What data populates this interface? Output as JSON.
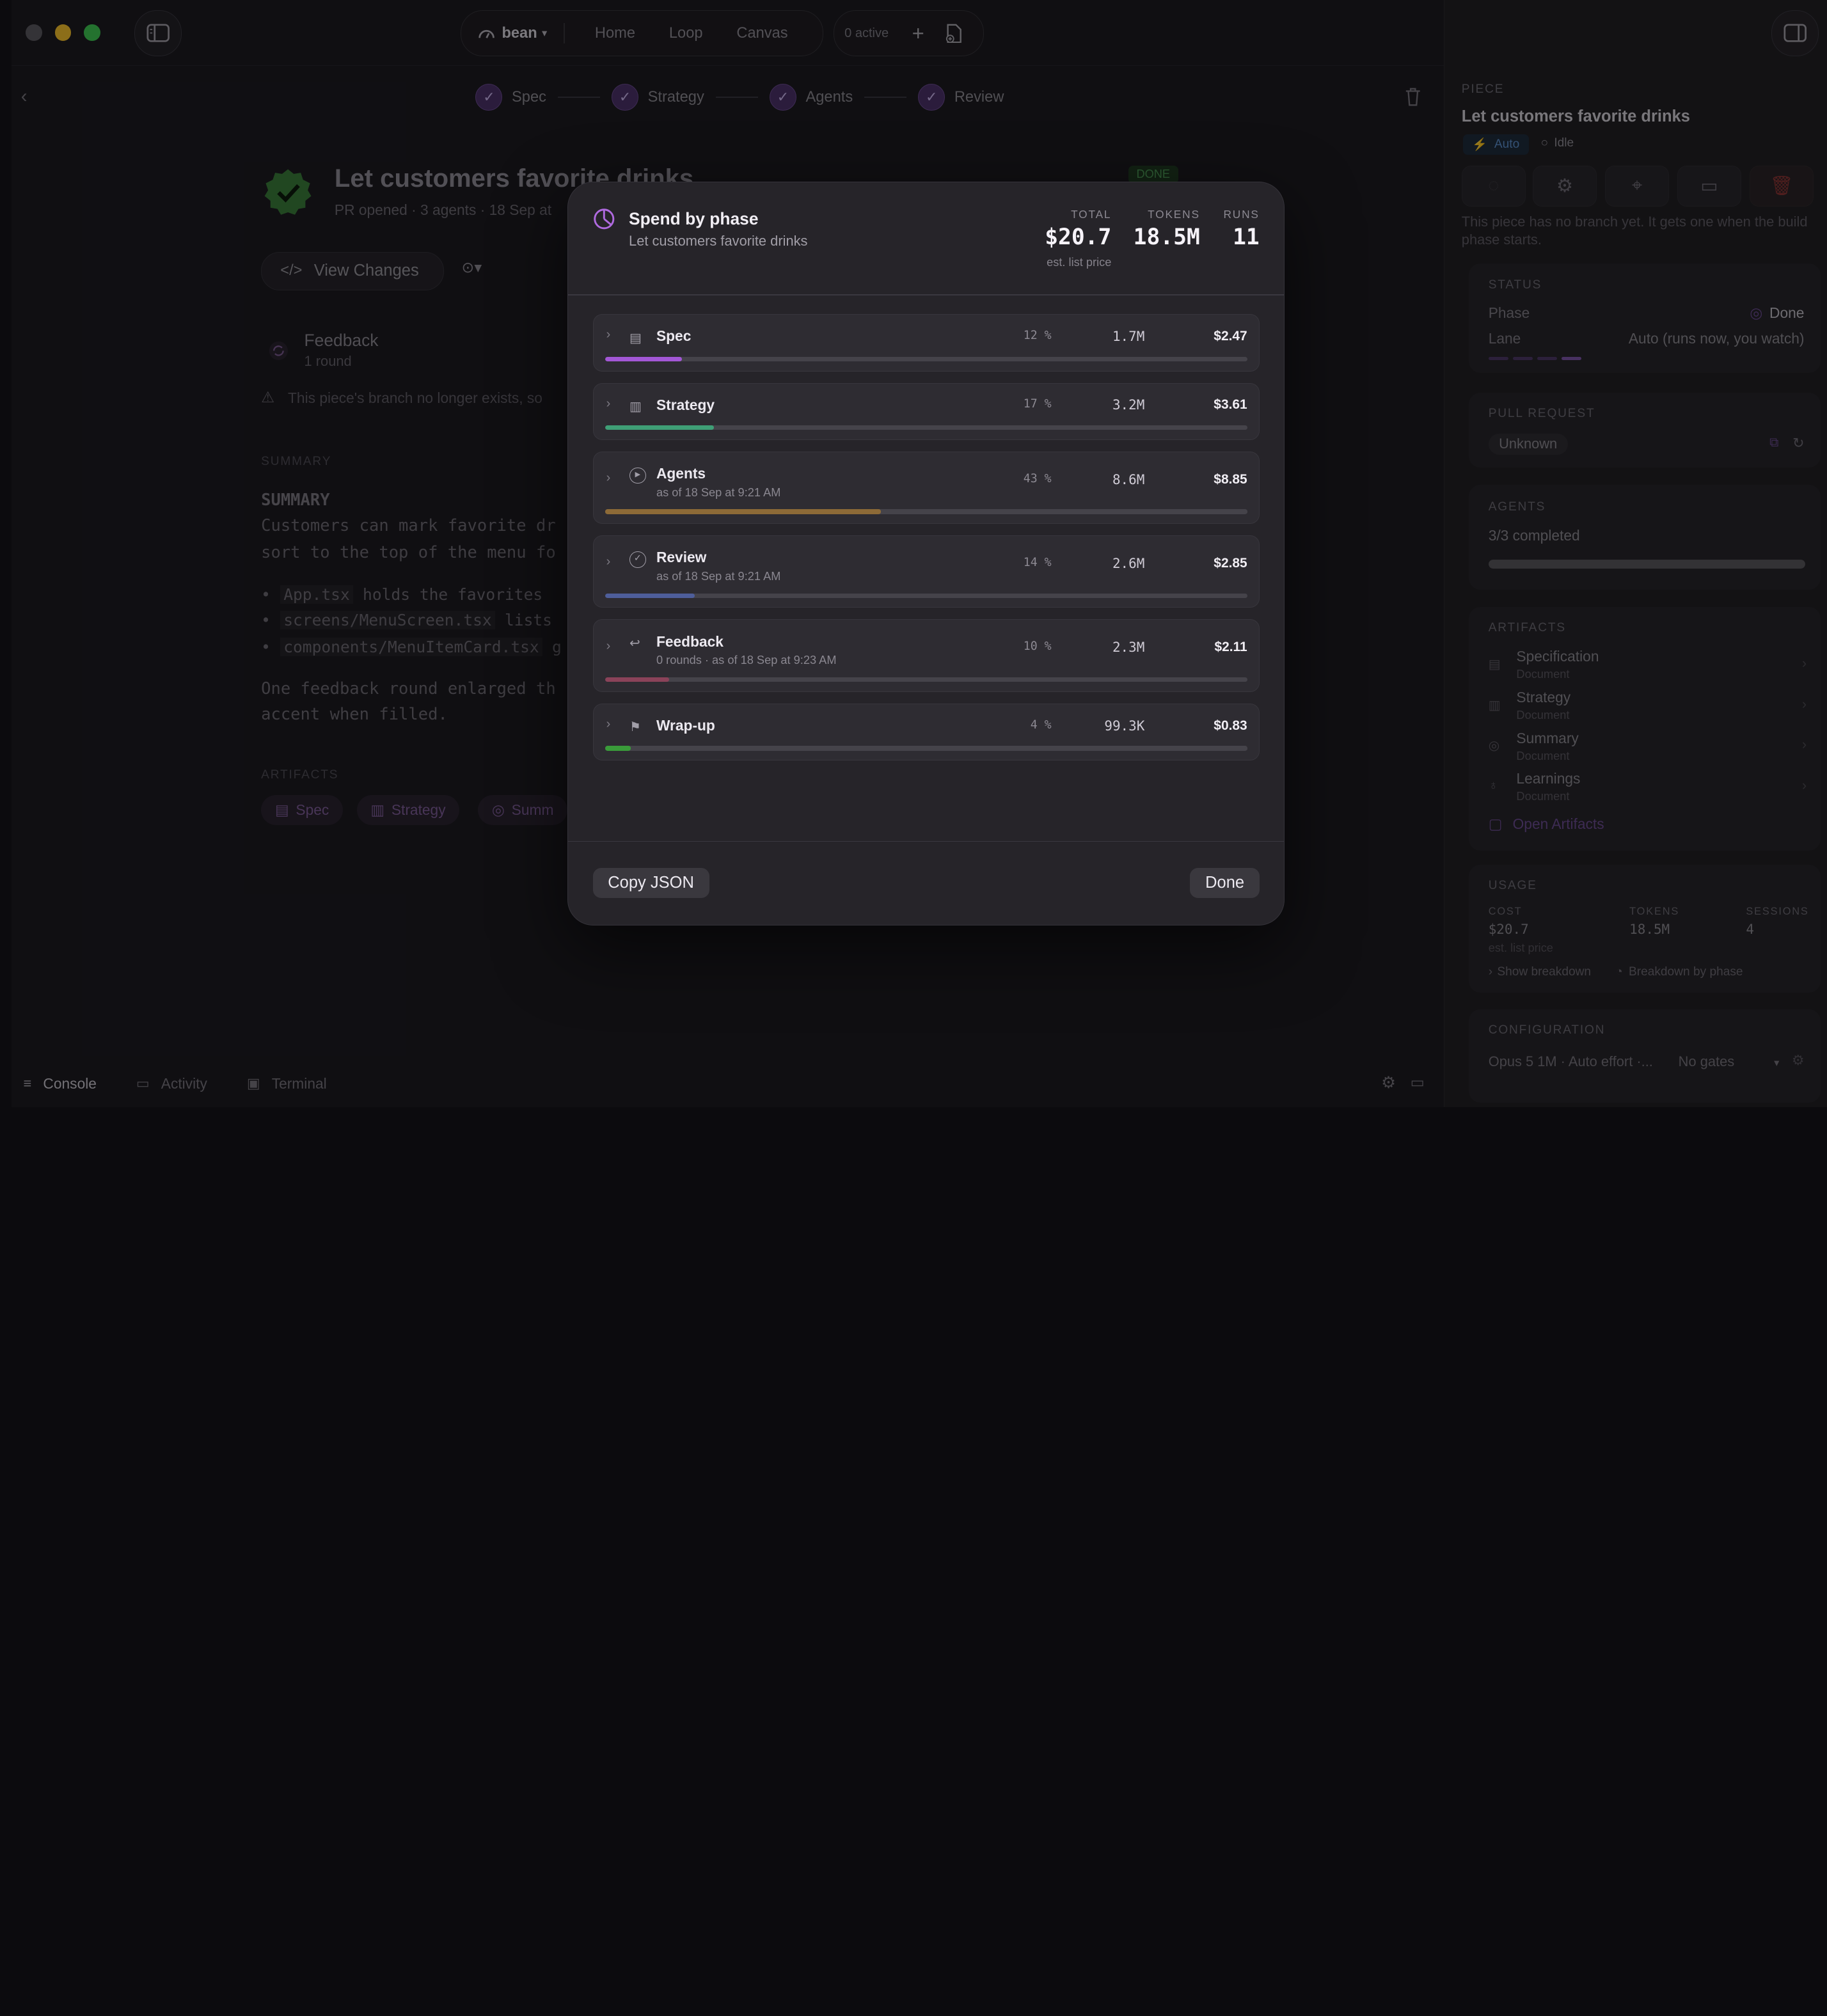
{
  "nav": {
    "workspace": "bean",
    "home": "Home",
    "loop": "Loop",
    "canvas": "Canvas",
    "active": "0 active"
  },
  "stepper": {
    "steps": [
      "Spec",
      "Strategy",
      "Agents",
      "Review"
    ]
  },
  "piece": {
    "title": "Let customers favorite drinks",
    "status_badge": "DONE",
    "subtitle": "PR opened · 3 agents · 18 Sep at",
    "view_changes": "View Changes",
    "feedback_title": "Feedback",
    "feedback_sub": "1 round",
    "warning": "This piece's branch no longer exists, so",
    "summary_cap": "SUMMARY",
    "summary_heading": "SUMMARY",
    "summary_l1": "Customers can mark favorite dr",
    "summary_l2": "sort to the top of the menu fo",
    "bullets": [
      {
        "code": "App.tsx",
        "rest": " holds the favorites"
      },
      {
        "code": "screens/MenuScreen.tsx",
        "rest": " lists"
      },
      {
        "code": "components/MenuItemCard.tsx",
        "rest": " g"
      }
    ],
    "para_l1": "One feedback round enlarged th",
    "para_l2": "accent when filled.",
    "artifacts_cap": "ARTIFACTS",
    "artifact_chips": [
      "Spec",
      "Strategy",
      "Summ"
    ]
  },
  "modal": {
    "title": "Spend by phase",
    "subtitle": "Let customers favorite drinks",
    "total_label": "TOTAL",
    "total": "$20.7",
    "total_note": "est. list price",
    "tokens_label": "TOKENS",
    "tokens": "18.5M",
    "runs_label": "RUNS",
    "runs": "11",
    "copy_json": "Copy JSON",
    "done": "Done",
    "phases": [
      {
        "name": "Spec",
        "sub": "",
        "pct": "12 %",
        "tokens": "1.7M",
        "cost": "$2.47",
        "share": 0.12,
        "color": "#a357d6",
        "icon": "document-icon"
      },
      {
        "name": "Strategy",
        "sub": "",
        "pct": "17 %",
        "tokens": "3.2M",
        "cost": "$3.61",
        "share": 0.17,
        "color": "#3f9f76",
        "icon": "map-icon"
      },
      {
        "name": "Agents",
        "sub": "as of 18 Sep at 9:21 AM",
        "pct": "43 %",
        "tokens": "8.6M",
        "cost": "$8.85",
        "share": 0.43,
        "color": "#8d6a37",
        "icon": "play-circle-icon"
      },
      {
        "name": "Review",
        "sub": "as of 18 Sep at 9:21 AM",
        "pct": "14 %",
        "tokens": "2.6M",
        "cost": "$2.85",
        "share": 0.14,
        "color": "#4e5e9a",
        "icon": "check-circle-icon"
      },
      {
        "name": "Feedback",
        "sub": "0 rounds · as of 18 Sep at 9:23 AM",
        "pct": "10 %",
        "tokens": "2.3M",
        "cost": "$2.11",
        "share": 0.1,
        "color": "#8a4259",
        "icon": "reply-icon"
      },
      {
        "name": "Wrap-up",
        "sub": "",
        "pct": "4 %",
        "tokens": "99.3K",
        "cost": "$0.83",
        "share": 0.04,
        "color": "#3a9b3a",
        "icon": "flag-icon"
      }
    ]
  },
  "side": {
    "piece_cap": "PIECE",
    "title": "Let customers favorite drinks",
    "auto": "Auto",
    "idle": "Idle",
    "no_branch": "This piece has no branch yet. It gets one when the build phase starts.",
    "status_cap": "STATUS",
    "phase_label": "Phase",
    "phase_value": "Done",
    "lane_label": "Lane",
    "lane_value": "Auto (runs now, you watch)",
    "pr_cap": "PULL REQUEST",
    "pr_value": "Unknown",
    "agents_cap": "AGENTS",
    "agents_value": "3/3 completed",
    "agents_progress": 1.0,
    "artifacts_cap": "ARTIFACTS",
    "artifacts": [
      {
        "name": "Specification",
        "type": "Document"
      },
      {
        "name": "Strategy",
        "type": "Document"
      },
      {
        "name": "Summary",
        "type": "Document"
      },
      {
        "name": "Learnings",
        "type": "Document"
      }
    ],
    "open_artifacts": "Open Artifacts",
    "usage_cap": "USAGE",
    "cost_label": "COST",
    "cost": "$20.7",
    "cost_note": "est. list price",
    "tokens_label": "TOKENS",
    "tokens": "18.5M",
    "sessions_label": "SESSIONS",
    "sessions": "4",
    "show_breakdown": "Show breakdown",
    "breakdown_by_phase": "Breakdown by phase",
    "config_cap": "CONFIGURATION",
    "config_value": "Opus 5 1M · Auto effort ·...",
    "gates": "No gates"
  },
  "bottom": {
    "console": "Console",
    "activity": "Activity",
    "terminal": "Terminal"
  }
}
